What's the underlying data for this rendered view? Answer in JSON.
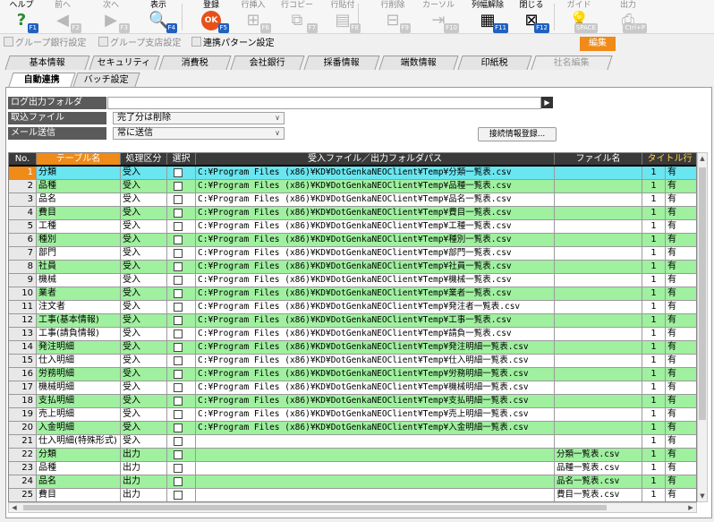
{
  "toolbar": {
    "buttons": [
      {
        "label": "ヘルプ",
        "key": "F1",
        "icon": "help-icon",
        "glyph": "?",
        "enabled": true
      },
      {
        "label": "前へ",
        "key": "F2",
        "icon": "arrow-left-icon",
        "glyph": "◀",
        "enabled": false
      },
      {
        "label": "次へ",
        "key": "F3",
        "icon": "arrow-right-icon",
        "glyph": "▶",
        "enabled": false
      },
      {
        "label": "表示",
        "key": "F4",
        "icon": "magnifier-icon",
        "glyph": "🔍",
        "enabled": true
      },
      {
        "label": "登録",
        "key": "F5",
        "icon": "ok-icon",
        "glyph": "OK",
        "enabled": true
      },
      {
        "label": "行挿入",
        "key": "F6",
        "icon": "row-insert-icon",
        "glyph": "⊞",
        "enabled": false
      },
      {
        "label": "行コピー",
        "key": "F7",
        "icon": "row-copy-icon",
        "glyph": "⧉",
        "enabled": false
      },
      {
        "label": "行貼付",
        "key": "F8",
        "icon": "row-paste-icon",
        "glyph": "▤",
        "enabled": false
      },
      {
        "label": "行削除",
        "key": "F9",
        "icon": "row-delete-icon",
        "glyph": "⊟",
        "enabled": false
      },
      {
        "label": "カーソル",
        "key": "F10",
        "icon": "cursor-icon",
        "glyph": "⇥",
        "enabled": false
      },
      {
        "label": "列幅解除",
        "key": "F11",
        "icon": "column-width-icon",
        "glyph": "▦",
        "enabled": true
      },
      {
        "label": "閉じる",
        "key": "F12",
        "icon": "close-door-icon",
        "glyph": "⊠",
        "enabled": true
      },
      {
        "label": "ガイド",
        "key": "SPACE",
        "icon": "lightbulb-icon",
        "glyph": "💡",
        "enabled": false
      },
      {
        "label": "出力",
        "key": "Ctrl+P",
        "icon": "print-icon",
        "glyph": "⎙",
        "enabled": false
      }
    ]
  },
  "subbar": {
    "items": [
      {
        "label": "グループ銀行設定",
        "enabled": false
      },
      {
        "label": "グループ支店設定",
        "enabled": false
      },
      {
        "label": "連携パターン設定",
        "enabled": true
      }
    ],
    "mode_badge": "編集"
  },
  "tabs_main": [
    {
      "label": "基本情報",
      "enabled": true
    },
    {
      "label": "セキュリティ",
      "enabled": true
    },
    {
      "label": "消費税",
      "enabled": true
    },
    {
      "label": "会社銀行",
      "enabled": true
    },
    {
      "label": "採番情報",
      "enabled": true
    },
    {
      "label": "端数情報",
      "enabled": true
    },
    {
      "label": "印紙税",
      "enabled": true
    },
    {
      "label": "社名編集",
      "enabled": false
    }
  ],
  "tabs_sub": [
    {
      "label": "自動連携",
      "active": true
    },
    {
      "label": "バッチ設定",
      "active": false
    }
  ],
  "form": {
    "log_folder_label": "ログ出力フォルダ",
    "log_folder_value": "",
    "browse_glyph": "▶",
    "import_file_label": "取込ファイル",
    "import_file_value": "完了分は削除",
    "mail_label": "メール送信",
    "mail_value": "常に送信",
    "register_button": "接続情報登録..."
  },
  "grid": {
    "columns": {
      "no": "No.",
      "table": "テーブル名",
      "process": "処理区分",
      "select": "選択",
      "path": "受入ファイル／出力フォルダパス",
      "file": "ファイル名",
      "title": "タイトル行"
    },
    "colors": {
      "green": "#9ff09f",
      "white": "#ffffff",
      "cyan": "#69e6f0",
      "selected_no": "#f08a18"
    },
    "rows": [
      {
        "no": "1",
        "table": "分類",
        "process": "受入",
        "path": "C:¥Program Files (x86)¥KD¥DotGenkaNEOClient¥Temp¥分類一覧表.csv",
        "file": "",
        "title": "1",
        "extra": "有",
        "hl": true,
        "green": false,
        "selected": true
      },
      {
        "no": "2",
        "table": "品種",
        "process": "受入",
        "path": "C:¥Program Files (x86)¥KD¥DotGenkaNEOClient¥Temp¥品種一覧表.csv",
        "file": "",
        "title": "1",
        "extra": "有",
        "green": true
      },
      {
        "no": "3",
        "table": "品名",
        "process": "受入",
        "path": "C:¥Program Files (x86)¥KD¥DotGenkaNEOClient¥Temp¥品名一覧表.csv",
        "file": "",
        "title": "1",
        "extra": "有",
        "green": false
      },
      {
        "no": "4",
        "table": "費目",
        "process": "受入",
        "path": "C:¥Program Files (x86)¥KD¥DotGenkaNEOClient¥Temp¥費目一覧表.csv",
        "file": "",
        "title": "1",
        "extra": "有",
        "green": true
      },
      {
        "no": "5",
        "table": "工種",
        "process": "受入",
        "path": "C:¥Program Files (x86)¥KD¥DotGenkaNEOClient¥Temp¥工種一覧表.csv",
        "file": "",
        "title": "1",
        "extra": "有",
        "green": false
      },
      {
        "no": "6",
        "table": "種別",
        "process": "受入",
        "path": "C:¥Program Files (x86)¥KD¥DotGenkaNEOClient¥Temp¥種別一覧表.csv",
        "file": "",
        "title": "1",
        "extra": "有",
        "green": true
      },
      {
        "no": "7",
        "table": "部門",
        "process": "受入",
        "path": "C:¥Program Files (x86)¥KD¥DotGenkaNEOClient¥Temp¥部門一覧表.csv",
        "file": "",
        "title": "1",
        "extra": "有",
        "green": false
      },
      {
        "no": "8",
        "table": "社員",
        "process": "受入",
        "path": "C:¥Program Files (x86)¥KD¥DotGenkaNEOClient¥Temp¥社員一覧表.csv",
        "file": "",
        "title": "1",
        "extra": "有",
        "green": true
      },
      {
        "no": "9",
        "table": "機械",
        "process": "受入",
        "path": "C:¥Program Files (x86)¥KD¥DotGenkaNEOClient¥Temp¥機械一覧表.csv",
        "file": "",
        "title": "1",
        "extra": "有",
        "green": false
      },
      {
        "no": "10",
        "table": "業者",
        "process": "受入",
        "path": "C:¥Program Files (x86)¥KD¥DotGenkaNEOClient¥Temp¥業者一覧表.csv",
        "file": "",
        "title": "1",
        "extra": "有",
        "green": true
      },
      {
        "no": "11",
        "table": "注文者",
        "process": "受入",
        "path": "C:¥Program Files (x86)¥KD¥DotGenkaNEOClient¥Temp¥発注者一覧表.csv",
        "file": "",
        "title": "1",
        "extra": "有",
        "green": false
      },
      {
        "no": "12",
        "table": "工事(基本情報)",
        "process": "受入",
        "path": "C:¥Program Files (x86)¥KD¥DotGenkaNEOClient¥Temp¥工事一覧表.csv",
        "file": "",
        "title": "1",
        "extra": "有",
        "green": true
      },
      {
        "no": "13",
        "table": "工事(請負情報)",
        "process": "受入",
        "path": "C:¥Program Files (x86)¥KD¥DotGenkaNEOClient¥Temp¥請負一覧表.csv",
        "file": "",
        "title": "1",
        "extra": "有",
        "green": false
      },
      {
        "no": "14",
        "table": "発注明細",
        "process": "受入",
        "path": "C:¥Program Files (x86)¥KD¥DotGenkaNEOClient¥Temp¥発注明細一覧表.csv",
        "file": "",
        "title": "1",
        "extra": "有",
        "green": true
      },
      {
        "no": "15",
        "table": "仕入明細",
        "process": "受入",
        "path": "C:¥Program Files (x86)¥KD¥DotGenkaNEOClient¥Temp¥仕入明細一覧表.csv",
        "file": "",
        "title": "1",
        "extra": "有",
        "green": false
      },
      {
        "no": "16",
        "table": "労務明細",
        "process": "受入",
        "path": "C:¥Program Files (x86)¥KD¥DotGenkaNEOClient¥Temp¥労務明細一覧表.csv",
        "file": "",
        "title": "1",
        "extra": "有",
        "green": true
      },
      {
        "no": "17",
        "table": "機械明細",
        "process": "受入",
        "path": "C:¥Program Files (x86)¥KD¥DotGenkaNEOClient¥Temp¥機械明細一覧表.csv",
        "file": "",
        "title": "1",
        "extra": "有",
        "green": false
      },
      {
        "no": "18",
        "table": "支払明細",
        "process": "受入",
        "path": "C:¥Program Files (x86)¥KD¥DotGenkaNEOClient¥Temp¥支払明細一覧表.csv",
        "file": "",
        "title": "1",
        "extra": "有",
        "green": true
      },
      {
        "no": "19",
        "table": "売上明細",
        "process": "受入",
        "path": "C:¥Program Files (x86)¥KD¥DotGenkaNEOClient¥Temp¥売上明細一覧表.csv",
        "file": "",
        "title": "1",
        "extra": "有",
        "green": false
      },
      {
        "no": "20",
        "table": "入金明細",
        "process": "受入",
        "path": "C:¥Program Files (x86)¥KD¥DotGenkaNEOClient¥Temp¥入金明細一覧表.csv",
        "file": "",
        "title": "1",
        "extra": "有",
        "green": true
      },
      {
        "no": "21",
        "table": "仕入明細(特殊形式)",
        "process": "受入",
        "path": "",
        "file": "",
        "title": "1",
        "extra": "有",
        "green": false
      },
      {
        "no": "22",
        "table": "分類",
        "process": "出力",
        "path": "",
        "file": "分類一覧表.csv",
        "title": "1",
        "extra": "有",
        "green": true
      },
      {
        "no": "23",
        "table": "品種",
        "process": "出力",
        "path": "",
        "file": "品種一覧表.csv",
        "title": "1",
        "extra": "有",
        "green": false
      },
      {
        "no": "24",
        "table": "品名",
        "process": "出力",
        "path": "",
        "file": "品名一覧表.csv",
        "title": "1",
        "extra": "有",
        "green": true
      },
      {
        "no": "25",
        "table": "費目",
        "process": "出力",
        "path": "",
        "file": "費目一覧表.csv",
        "title": "1",
        "extra": "有",
        "green": false
      }
    ]
  }
}
